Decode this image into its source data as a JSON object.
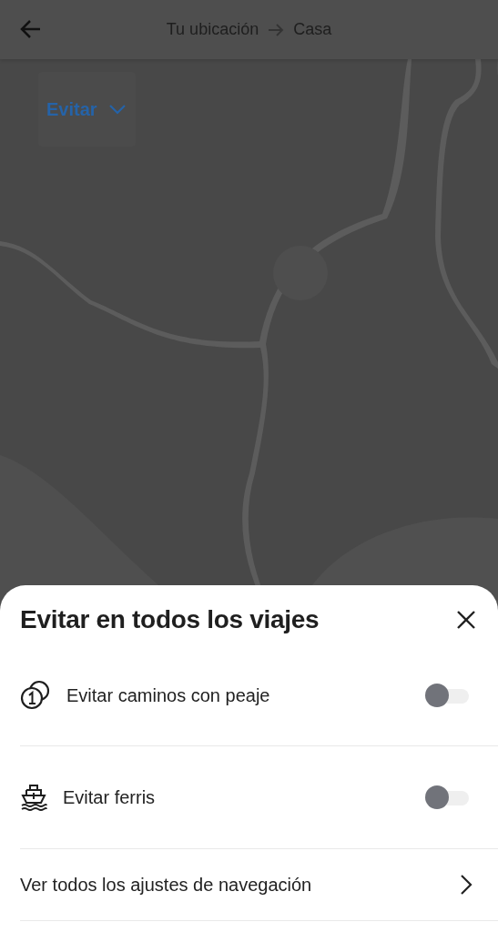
{
  "header": {
    "origin": "Tu ubicación",
    "destination": "Casa"
  },
  "filter_chip": {
    "label": "Evitar"
  },
  "sheet": {
    "title": "Evitar en todos los viajes",
    "options": [
      {
        "kind": "toll",
        "label": "Evitar caminos con peaje",
        "on": false
      },
      {
        "kind": "ferry",
        "label": "Evitar ferris",
        "on": false
      }
    ],
    "link": "Ver todos los ajustes de navegación"
  }
}
